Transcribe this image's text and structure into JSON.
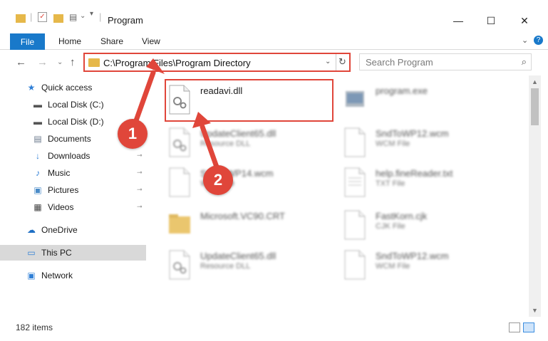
{
  "window": {
    "title": "Program",
    "minimize_glyph": "—",
    "maximize_glyph": "☐",
    "close_glyph": "✕"
  },
  "ribbon": {
    "tabs": [
      "File",
      "Home",
      "Share",
      "View"
    ],
    "collapse_glyph": "⌄",
    "help_glyph": "?"
  },
  "nav": {
    "back_glyph": "←",
    "forward_glyph": "→",
    "recent_glyph": "⌄",
    "up_glyph": "↑",
    "address_path": "C:\\Program Files\\Program Directory",
    "address_dropdown_glyph": "⌄",
    "refresh_glyph": "↻",
    "search_placeholder": "Search Program",
    "search_glyph": "⌕"
  },
  "sidebar": {
    "items": [
      {
        "label": "Quick access",
        "icon": "star-icon",
        "glyph": "★",
        "color": "#2f7fd6",
        "pinned": false
      },
      {
        "label": "Local Disk (C:)",
        "icon": "drive-icon",
        "glyph": "▬",
        "color": "#555555",
        "pinned": false
      },
      {
        "label": "Local Disk (D:)",
        "icon": "drive-icon",
        "glyph": "▬",
        "color": "#555555",
        "pinned": false
      },
      {
        "label": "Documents",
        "icon": "documents-icon",
        "glyph": "▤",
        "color": "#6b7a8c",
        "pinned": false
      },
      {
        "label": "Downloads",
        "icon": "downloads-icon",
        "glyph": "↓",
        "color": "#2f7fd6",
        "pinned": true
      },
      {
        "label": "Music",
        "icon": "music-icon",
        "glyph": "♪",
        "color": "#2f7fd6",
        "pinned": true
      },
      {
        "label": "Pictures",
        "icon": "pictures-icon",
        "glyph": "▣",
        "color": "#4a8bc8",
        "pinned": true
      },
      {
        "label": "Videos",
        "icon": "videos-icon",
        "glyph": "▦",
        "color": "#444444",
        "pinned": true
      },
      {
        "label": "OneDrive",
        "icon": "onedrive-icon",
        "glyph": "☁",
        "color": "#1e6fc4",
        "pinned": false
      },
      {
        "label": "This PC",
        "icon": "this-pc-icon",
        "glyph": "▭",
        "color": "#2f7fd6",
        "pinned": false
      },
      {
        "label": "Network",
        "icon": "network-icon",
        "glyph": "▣",
        "color": "#2f7fd6",
        "pinned": false
      }
    ],
    "pin_glyph": "📌"
  },
  "files": [
    {
      "name": "readavi.dll",
      "type": "",
      "icon": "dll-file-icon",
      "clear": true
    },
    {
      "name": "program.exe",
      "type": "",
      "icon": "exe-file-icon",
      "clear": false
    },
    {
      "name": "UpdateClient65.dll",
      "type": "Resource DLL",
      "icon": "dll-file-icon",
      "clear": false
    },
    {
      "name": "SndToWP12.wcm",
      "type": "WCM File",
      "icon": "blank-file-icon",
      "clear": false
    },
    {
      "name": "SndToWP14.wcm",
      "type": "WCM File",
      "icon": "blank-file-icon",
      "clear": false
    },
    {
      "name": "help.fineReader.txt",
      "type": "TXT File",
      "icon": "text-file-icon",
      "clear": false
    },
    {
      "name": "Microsoft.VC90.CRT",
      "type": "",
      "icon": "folder-icon",
      "clear": false
    },
    {
      "name": "FastKorn.cjk",
      "type": "CJK File",
      "icon": "blank-file-icon",
      "clear": false
    },
    {
      "name": "UpdateClient65.dll",
      "type": "Resource DLL",
      "icon": "dll-file-icon",
      "clear": false
    },
    {
      "name": "SndToWP12.wcm",
      "type": "WCM File",
      "icon": "blank-file-icon",
      "clear": false
    }
  ],
  "status": {
    "item_count": "182 items"
  },
  "annotations": {
    "step1": "1",
    "step2": "2",
    "color": "#e0463a"
  },
  "colors": {
    "accent": "#1979ca",
    "highlight": "#e0463a",
    "folder": "#e6b84a",
    "selection": "#d9d9d9"
  }
}
